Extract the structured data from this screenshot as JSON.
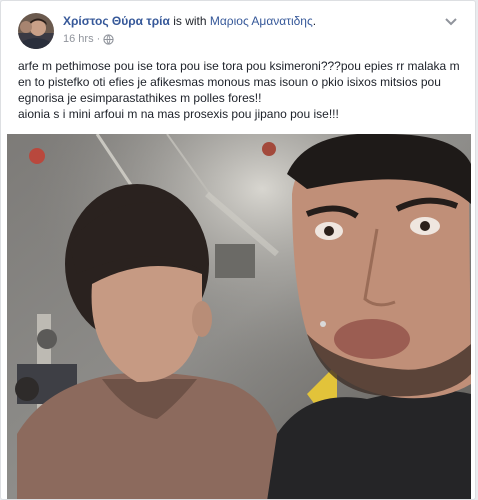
{
  "post": {
    "author": "Χρίστος Θύρα τρία",
    "with_text": "is with",
    "tagged": "Μαριος Αμανατιδης",
    "tagged_suffix": ".",
    "timestamp": "16 hrs",
    "separator": "·",
    "privacy_icon": "globe-icon",
    "options_icon": "chevron-down-icon",
    "text_para1": "arfe m pethimose pou ise tora pou ise tora pou ksimeroni???pou epies rr malaka m en to pistefko oti efies je afikesmas monous mas isoun o pkio isixos mitsios pou egnorisa je esimparastathikes m polles fores!!",
    "text_para2": "aionia s i mini arfoui m na mas prosexis pou jipano pou ise!!!"
  },
  "colors": {
    "link": "#365899",
    "text": "#1d2129",
    "meta": "#90949c",
    "card_border": "#dddfe2"
  }
}
